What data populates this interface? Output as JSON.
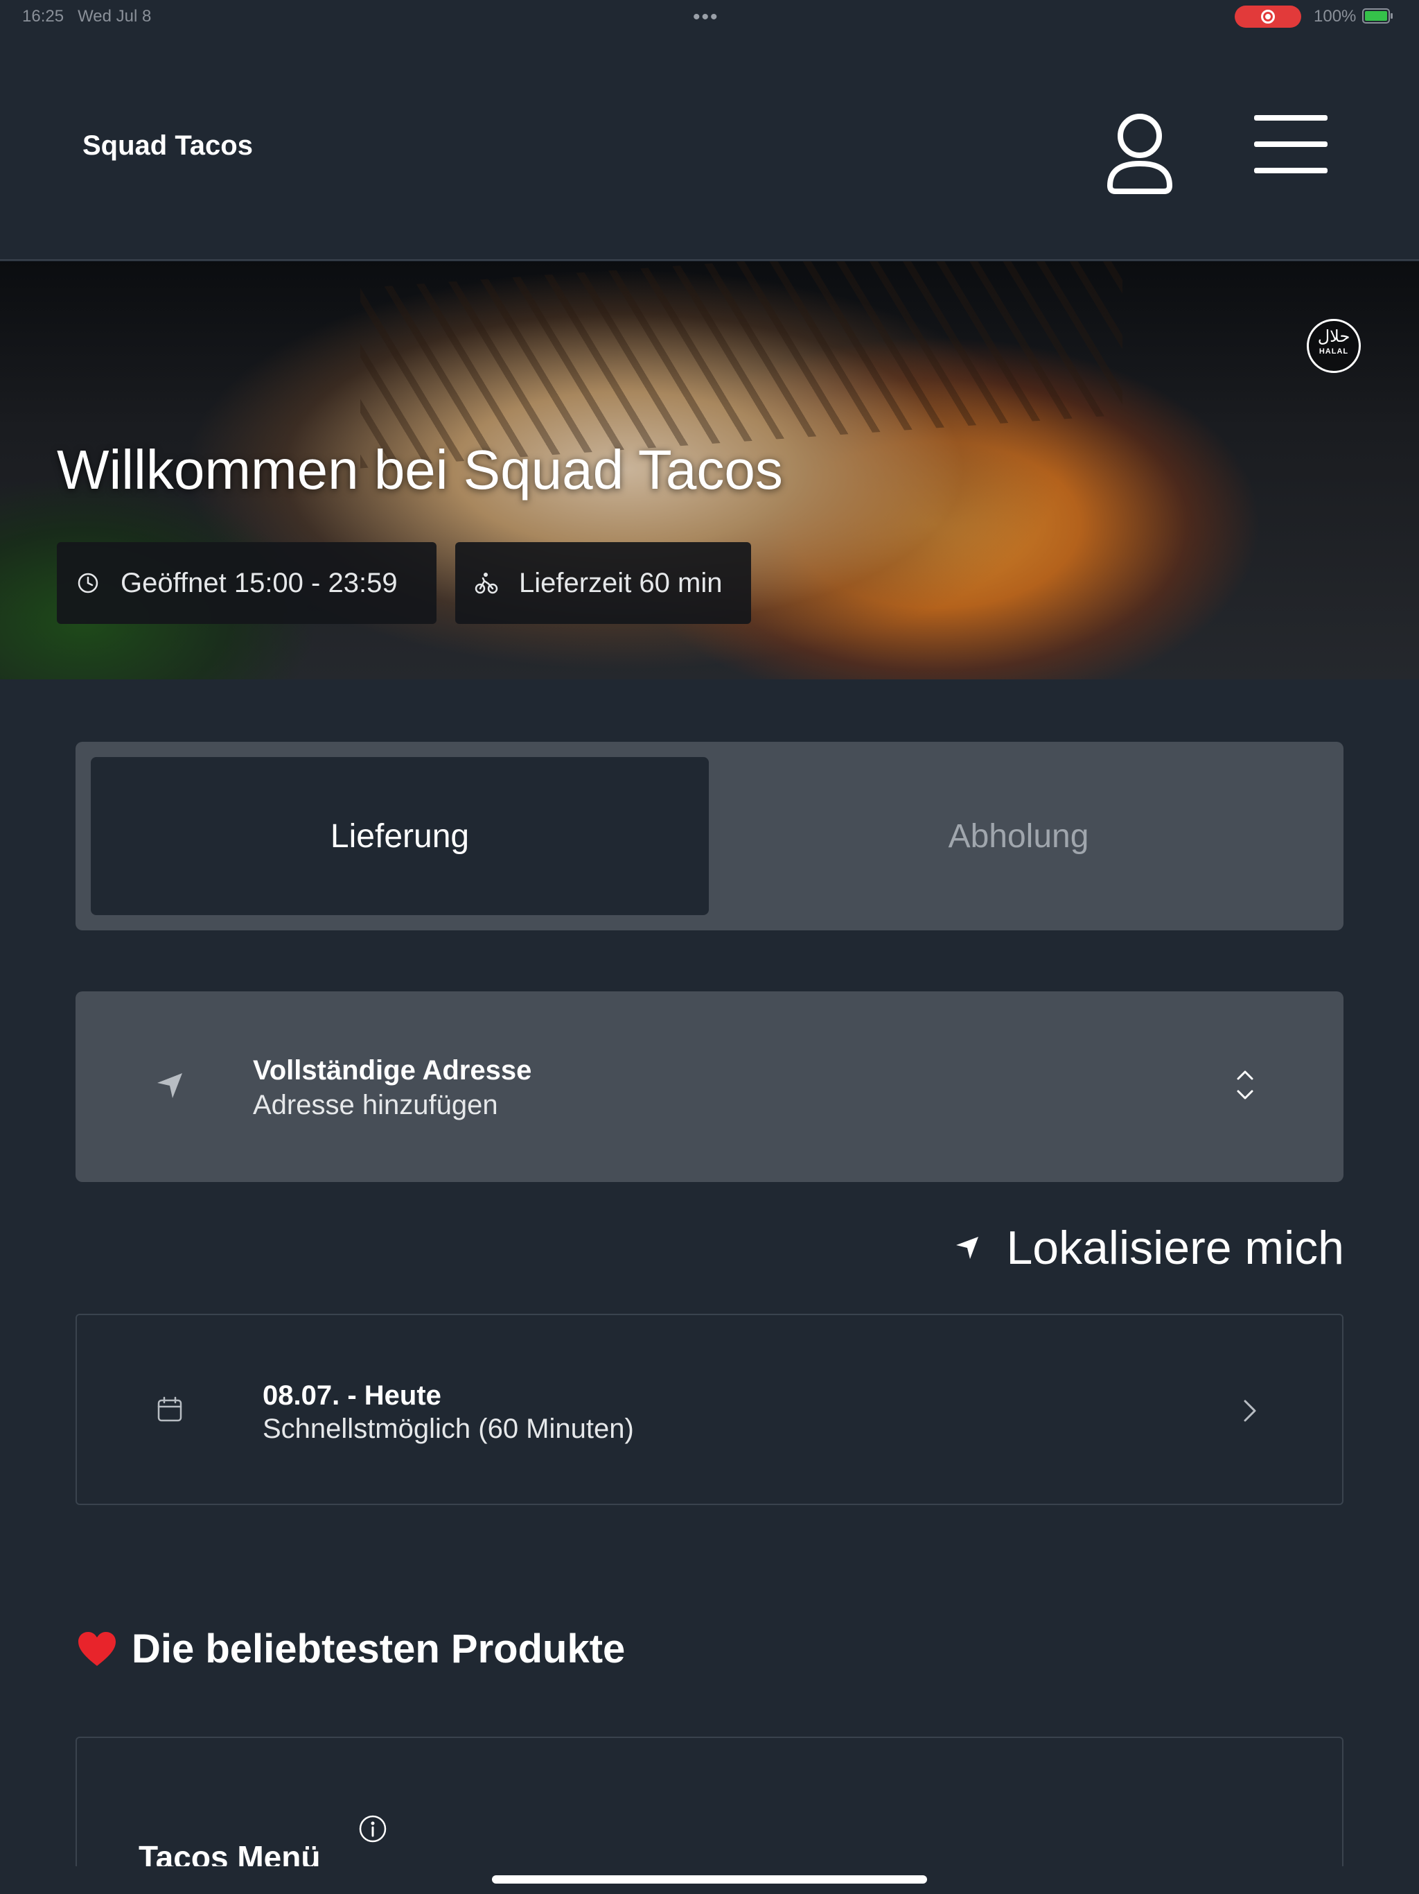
{
  "status_bar": {
    "time": "16:25",
    "date": "Wed Jul 8",
    "dots": "•••",
    "battery": "100%"
  },
  "header": {
    "brand": "Squad Tacos",
    "profile_icon": "user-icon",
    "menu_icon": "hamburger-menu-icon"
  },
  "hero": {
    "title": "Willkommen bei Squad Tacos",
    "halal_arabic": "حلال",
    "halal_label": "HALAL",
    "opening_hours": "Geöffnet 15:00 - 23:59",
    "delivery_time": "Lieferzeit 60 min"
  },
  "order_type": {
    "delivery": "Lieferung",
    "pickup": "Abholung",
    "selected": "delivery"
  },
  "address": {
    "title": "Vollständige Adresse",
    "placeholder": "Adresse hinzufügen"
  },
  "locate": {
    "label": "Lokalisiere mich"
  },
  "schedule": {
    "date": "08.07. - Heute",
    "time": "Schnellstmöglich (60 Minuten)"
  },
  "popular": {
    "title": "Die beliebtesten Produkte",
    "products": [
      {
        "name": "Tacos Menü"
      }
    ]
  },
  "colors": {
    "background": "#202832",
    "card": "#474e57",
    "accent_red": "#e23a3a"
  }
}
